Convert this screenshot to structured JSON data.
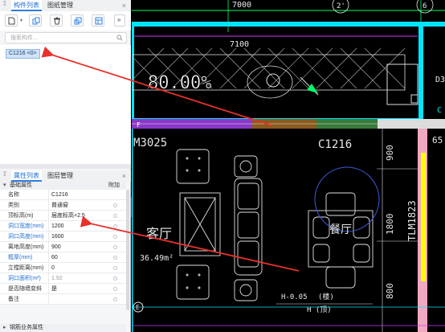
{
  "panel_top": {
    "tabs": [
      {
        "label": "构件列表"
      },
      {
        "label": "图纸管理"
      }
    ],
    "close": "×",
    "toolbar": {
      "more": "»"
    },
    "search": {
      "placeholder": "搜索构件..."
    },
    "components": [
      {
        "label": "C1216 <0>"
      }
    ]
  },
  "panel_bottom": {
    "tabs": [
      {
        "label": "属性列表"
      },
      {
        "label": "图层管理"
      }
    ],
    "close": "×",
    "section_expand": "▾",
    "section_title": "基础属性",
    "add_column": "附加",
    "rows": [
      {
        "name": "名称",
        "value": "C1216",
        "name_blue": false
      },
      {
        "name": "类别",
        "value": "普通窗",
        "name_blue": false
      },
      {
        "name": "顶标高(m)",
        "value": "层底标高+2.5",
        "name_blue": false
      },
      {
        "name": "洞口宽度(mm)",
        "value": "1200",
        "name_blue": true
      },
      {
        "name": "洞口高度(mm)",
        "value": "1600",
        "name_blue": true
      },
      {
        "name": "离地高度(mm)",
        "value": "900",
        "name_blue": false
      },
      {
        "name": "框厚(mm)",
        "value": "60",
        "name_blue": true
      },
      {
        "name": "立樘距离(mm)",
        "value": "0",
        "name_blue": false
      },
      {
        "name": "洞口面积(m²)",
        "value": "1.92",
        "name_blue": true,
        "value_grey": true
      },
      {
        "name": "是否随墙变斜",
        "value": "是",
        "name_blue": false
      },
      {
        "name": "备注",
        "value": "",
        "name_blue": false
      }
    ],
    "footer_expand": "▸",
    "footer_title": "钢筋业务属性"
  },
  "collapse_arrow": "‹",
  "cad": {
    "dim_7000": "7000",
    "dim_7100": "7100",
    "axis_2": "2'",
    "axis_6": "6",
    "axis_f": "F",
    "axis_e": "E",
    "percent": "80.00%",
    "m3025": "M3025",
    "c1216": "C1216",
    "dim_900": "900",
    "dim_1800": "1800",
    "dim_800": "800",
    "tlm": "TLM1823",
    "living_room": "客厅",
    "area": "36.49m²",
    "dining": "餐厅",
    "h_005": "H-0.05",
    "lou": "(楼)",
    "h_ding": "H (顶)",
    "num_65": "65",
    "d3": "D3",
    "c_edge": "C"
  },
  "colors": {
    "accent": "#1f6fd1",
    "cad_cyan": "#00e5ff",
    "cad_green": "#00ff66",
    "cad_magenta": "#d23cff",
    "cad_yellow": "#ffff00",
    "arrow_red": "#e8312a"
  }
}
